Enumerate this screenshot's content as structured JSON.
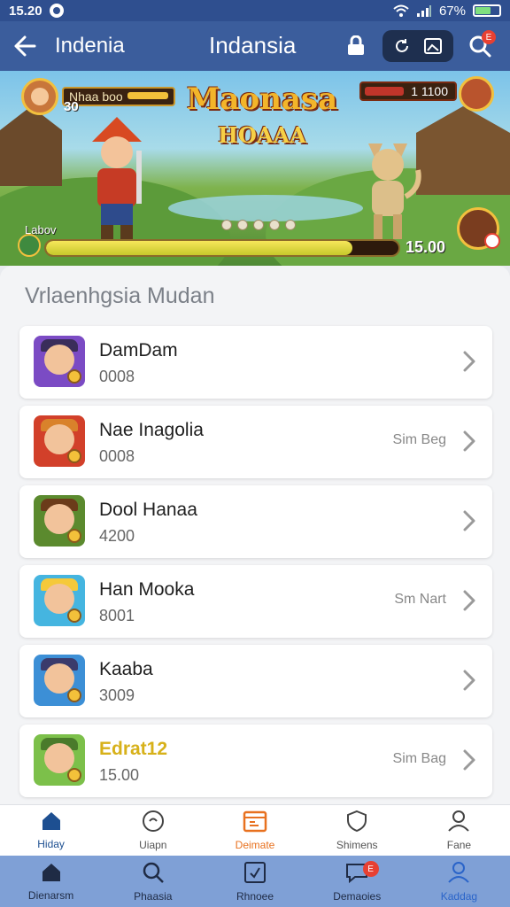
{
  "status_bar": {
    "time": "15.20",
    "battery": "67%",
    "battery_level": 0.67
  },
  "app_bar": {
    "back_icon": "arrow-left-icon",
    "subtitle": "Indenia",
    "title": "Indansia",
    "actions": [
      "lock-icon",
      "refresh-icon",
      "image-icon",
      "search-icon"
    ],
    "search_badge": "E"
  },
  "banner": {
    "title_line1": "Maonasa",
    "title_line2": "HOAAA",
    "player_name": "Nhaa boo",
    "coins": "30",
    "score": "1 1100",
    "level_label": "Labov",
    "progress_value": "15.00",
    "progress_fraction": 0.87
  },
  "section": {
    "title": "Vrlaenhgsia Mudan"
  },
  "items": [
    {
      "name": "DamDam",
      "value": "0008",
      "status": "",
      "thumb_bg": "#7b4bc4",
      "hat_color": "#3a2d5a"
    },
    {
      "name": "Nae Inagolia",
      "value": "0008",
      "status": "Sim Beg",
      "thumb_bg": "#d2402a",
      "hat_color": "#d9822b"
    },
    {
      "name": "Dool Hanaa",
      "value": "4200",
      "status": "",
      "thumb_bg": "#5b8a2e",
      "hat_color": "#6b3b1a"
    },
    {
      "name": "Han Mooka",
      "value": "8001",
      "status": "Sm Nart",
      "thumb_bg": "#45b5e0",
      "hat_color": "#f5c93a"
    },
    {
      "name": "Kaaba",
      "value": "3009",
      "status": "",
      "thumb_bg": "#3c8fd6",
      "hat_color": "#3b3b6b"
    },
    {
      "name": "Edrat12",
      "value": "15.00",
      "status": "Sim Bag",
      "thumb_bg": "#7cc04a",
      "hat_color": "#4a7a2b"
    }
  ],
  "tabs_top": [
    {
      "label": "Hiday",
      "icon": "home-icon",
      "state": "active"
    },
    {
      "label": "Uiapn",
      "icon": "compass-icon",
      "state": ""
    },
    {
      "label": "Deimate",
      "icon": "calendar-icon",
      "state": "orange"
    },
    {
      "label": "Shimens",
      "icon": "shield-icon",
      "state": ""
    },
    {
      "label": "Fane",
      "icon": "user-icon",
      "state": ""
    }
  ],
  "tabs_bottom": [
    {
      "label": "Dienarsm",
      "icon": "home-icon",
      "state": ""
    },
    {
      "label": "Phaasia",
      "icon": "search-icon",
      "state": ""
    },
    {
      "label": "Rhnoee",
      "icon": "checkbox-icon",
      "state": ""
    },
    {
      "label": "Demaoies",
      "icon": "chat-icon",
      "state": "",
      "badge": "E"
    },
    {
      "label": "Kaddag",
      "icon": "user-icon",
      "state": "blue"
    }
  ],
  "colors": {
    "status_bar": "#2f4f8f",
    "app_bar": "#3b5d9c",
    "bottom_nav": "#7fa0d6",
    "accent_orange": "#e8711f",
    "badge_red": "#e74032"
  }
}
